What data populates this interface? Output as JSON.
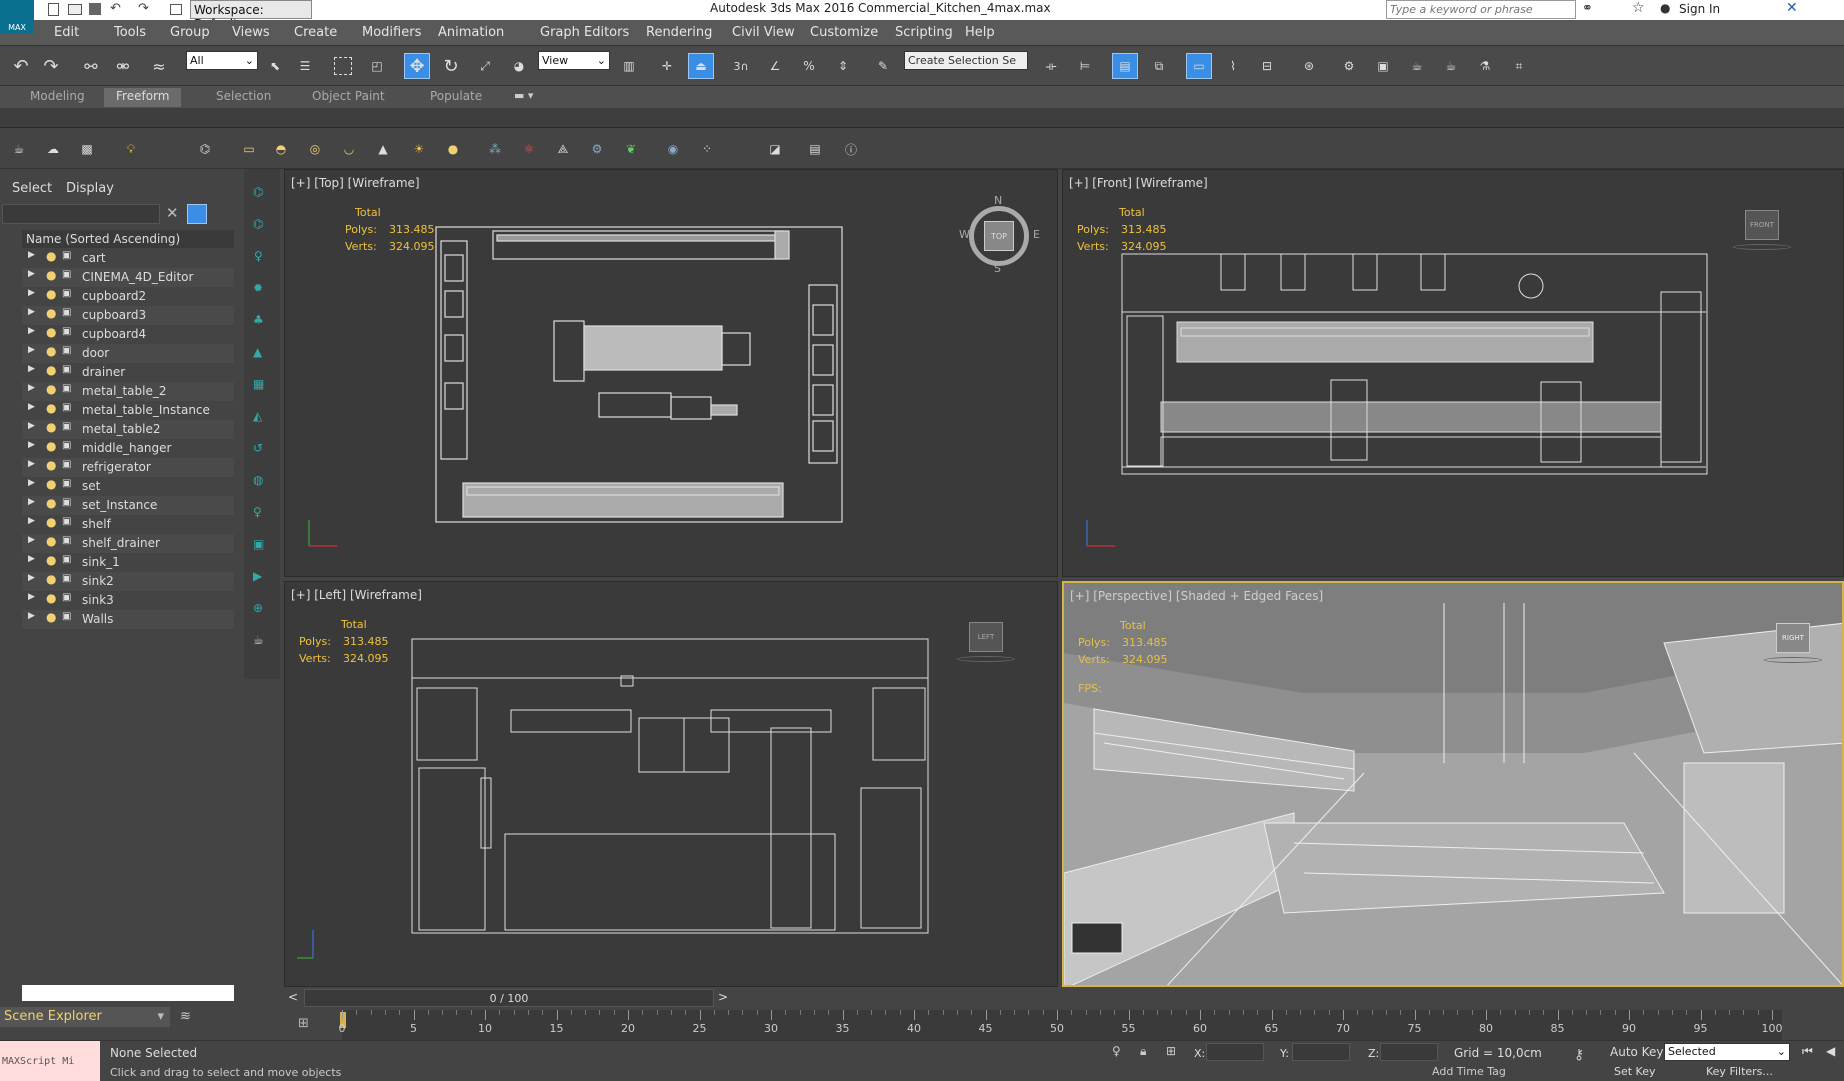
{
  "app_title": "Autodesk 3ds Max 2016",
  "file_name": "Commercial_Kitchen_4max.max",
  "workspace": "Workspace: Default",
  "search_placeholder": "Type a keyword or phrase",
  "sign_in": "Sign In",
  "max_logo": "MAX",
  "menu": [
    "Edit",
    "Tools",
    "Group",
    "Views",
    "Create",
    "Modifiers",
    "Animation",
    "Graph Editors",
    "Rendering",
    "Civil View",
    "Customize",
    "Scripting",
    "Help"
  ],
  "toolbar": {
    "filter_value": "All",
    "refcoord": "View",
    "selection_set": "Create Selection Se",
    "snap_label": "3"
  },
  "ribbon_tabs": [
    "Modeling",
    "Freeform",
    "Selection",
    "Object Paint",
    "Populate"
  ],
  "scene_explorer": {
    "tabs": [
      "Select",
      "Display"
    ],
    "column_header": "Name (Sorted Ascending)",
    "items": [
      "cart",
      "CINEMA_4D_Editor",
      "cupboard2",
      "cupboard3",
      "cupboard4",
      "door",
      "drainer",
      "metal_table_2",
      "metal_table_Instance",
      "metal_table2",
      "middle_hanger",
      "refrigerator",
      "set",
      "set_Instance",
      "shelf",
      "shelf_drainer",
      "sink_1",
      "sink2",
      "sink3",
      "Walls"
    ],
    "footer": "Scene Explorer"
  },
  "viewports": {
    "top": {
      "label": "[+] [Top] [Wireframe]",
      "cube": "TOP"
    },
    "front": {
      "label": "[+] [Front] [Wireframe]",
      "cube": "FRONT"
    },
    "left": {
      "label": "[+] [Left] [Wireframe]",
      "cube": "LEFT"
    },
    "persp": {
      "label": "[+] [Perspective] [Shaded + Edged Faces]",
      "cube": "RIGHT"
    }
  },
  "stats": {
    "total": "Total",
    "polys_label": "Polys:",
    "polys": "313.485",
    "verts_label": "Verts:",
    "verts": "324.095",
    "fps": "FPS:"
  },
  "compass": {
    "n": "N",
    "s": "S",
    "w": "W",
    "e": "E"
  },
  "timeline": {
    "frame": "0 / 100",
    "ticks": [
      "0",
      "5",
      "10",
      "15",
      "20",
      "25",
      "30",
      "35",
      "40",
      "45",
      "50",
      "55",
      "60",
      "65",
      "70",
      "75",
      "80",
      "85",
      "90",
      "95",
      "100"
    ]
  },
  "status": {
    "selection": "None Selected",
    "prompt": "Click and drag to select and move objects",
    "x": "X:",
    "y": "Y:",
    "z": "Z:",
    "grid": "Grid = 10,0cm",
    "add_time_tag": "Add Time Tag",
    "auto_key": "Auto Key",
    "set_key": "Set Key",
    "selected": "Selected",
    "key_filters": "Key Filters...",
    "maxscript": "MAXScript Mi"
  },
  "colors": {
    "accent": "#3a8ee6",
    "stats": "#f0c23a",
    "active_border": "#d8b34a"
  }
}
